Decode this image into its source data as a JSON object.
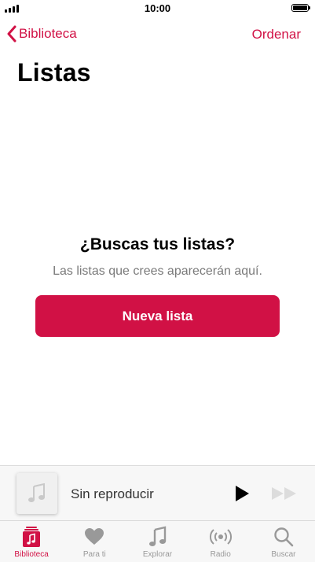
{
  "status_bar": {
    "time": "10:00"
  },
  "nav": {
    "back_label": "Biblioteca",
    "action_label": "Ordenar"
  },
  "page": {
    "title": "Listas"
  },
  "empty_state": {
    "title": "¿Buscas tus listas?",
    "subtitle": "Las listas que crees aparecerán aquí.",
    "button_label": "Nueva lista"
  },
  "mini_player": {
    "title": "Sin reproducir"
  },
  "tabs": [
    {
      "label": "Biblioteca",
      "icon": "library-icon",
      "active": true
    },
    {
      "label": "Para ti",
      "icon": "heart-icon",
      "active": false
    },
    {
      "label": "Explorar",
      "icon": "music-note-icon",
      "active": false
    },
    {
      "label": "Radio",
      "icon": "radio-icon",
      "active": false
    },
    {
      "label": "Buscar",
      "icon": "search-icon",
      "active": false
    }
  ],
  "colors": {
    "accent": "#d11145",
    "inactive": "#999999",
    "subtitle": "#7a7a7a"
  }
}
